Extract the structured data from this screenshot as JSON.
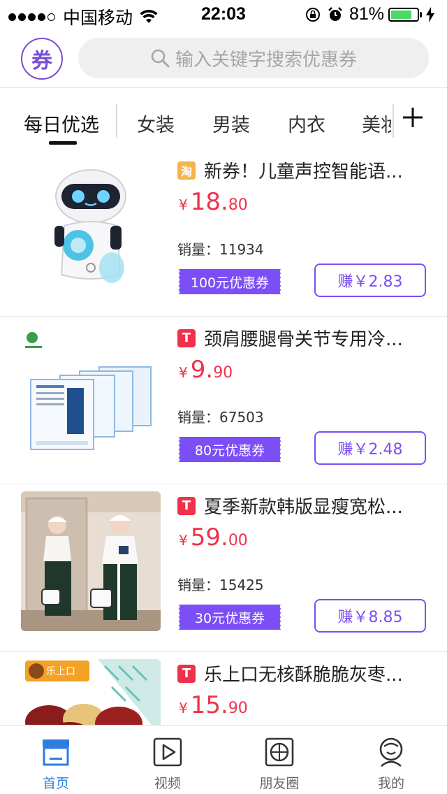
{
  "status_bar": {
    "carrier": "中国移动",
    "time": "22:03",
    "battery": "81%",
    "battery_level": 0.81
  },
  "header": {
    "logo_text": "券",
    "search_placeholder": "输入关键字搜索优惠券"
  },
  "tabs": {
    "items": [
      "每日优选",
      "女装",
      "男装",
      "内衣",
      "美妆"
    ],
    "active_index": 0
  },
  "products": [
    {
      "platform": "淘",
      "title": "新券！儿童声控智能语...",
      "price_currency": "¥",
      "price_int": "18.",
      "price_dec": "80",
      "sales_label": "销量：",
      "sales": "11934",
      "coupon": "100元优惠券",
      "earn": "赚￥2.83"
    },
    {
      "platform": "T",
      "title": "颈肩腰腿骨关节专用冷...",
      "price_currency": "¥",
      "price_int": "9.",
      "price_dec": "90",
      "sales_label": "销量：",
      "sales": "67503",
      "coupon": "80元优惠券",
      "earn": "赚￥2.48"
    },
    {
      "platform": "T",
      "title": "夏季新款韩版显瘦宽松...",
      "price_currency": "¥",
      "price_int": "59.",
      "price_dec": "00",
      "sales_label": "销量：",
      "sales": "15425",
      "coupon": "30元优惠券",
      "earn": "赚￥8.85"
    },
    {
      "platform": "T",
      "title": "乐上口无核酥脆脆灰枣...",
      "price_currency": "¥",
      "price_int": "15.",
      "price_dec": "90",
      "image_text": "乐上口"
    }
  ],
  "bottom_nav": {
    "items": [
      "首页",
      "视频",
      "朋友圈",
      "我的"
    ],
    "active_index": 0
  },
  "colors": {
    "brand_purple": "#7b4ff5",
    "price_red": "#f0314b",
    "active_blue": "#2d7de0",
    "tmall_red": "#f0314b",
    "taobao_orange": "#f5b54a"
  }
}
